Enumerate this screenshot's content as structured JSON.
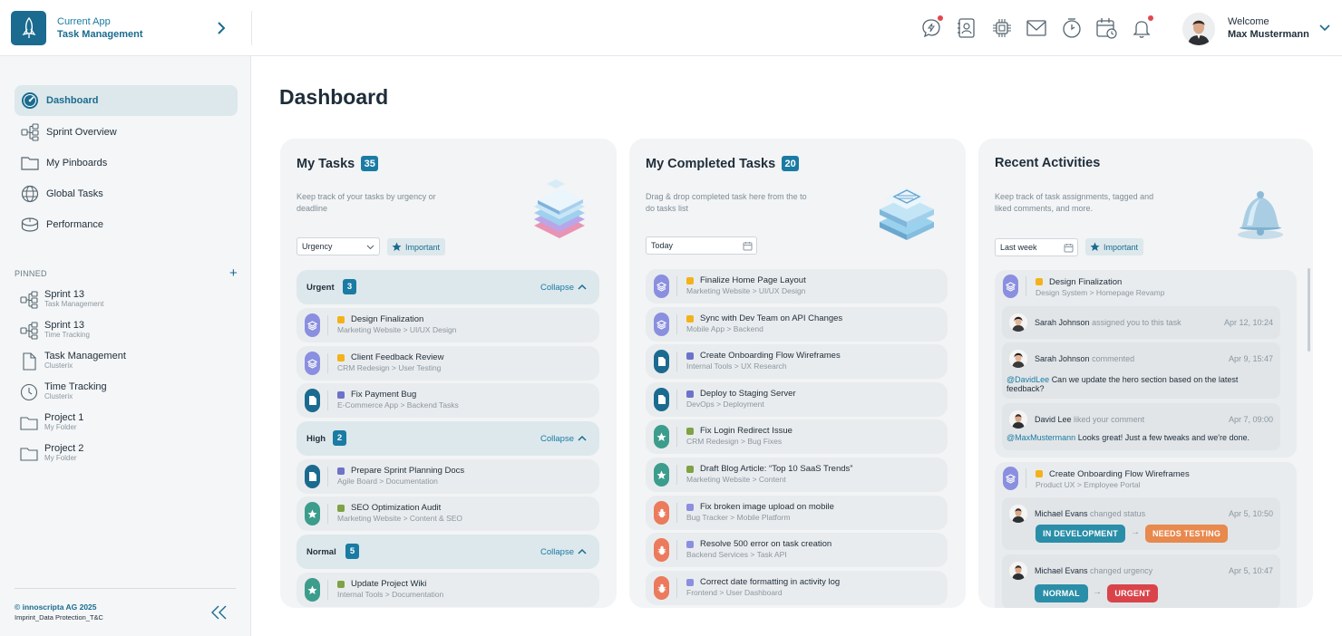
{
  "app": {
    "label": "Current App",
    "name": "Task Management"
  },
  "header": {
    "icons": [
      "chat-icon",
      "contacts-icon",
      "chip-icon",
      "mail-icon",
      "clock-icon",
      "calendar-icon",
      "bell-icon"
    ],
    "welcome": "Welcome",
    "user_name": "Max Mustermann"
  },
  "sidebar": {
    "items": [
      {
        "label": "Dashboard",
        "icon": "gauge-icon",
        "active": true
      },
      {
        "label": "Sprint Overview",
        "icon": "hierarchy-icon"
      },
      {
        "label": "My Pinboards",
        "icon": "folder-icon"
      },
      {
        "label": "Global Tasks",
        "icon": "globe-icon"
      },
      {
        "label": "Performance",
        "icon": "chart-icon"
      }
    ],
    "pinned_label": "PINNED",
    "pinned_add": "+",
    "pinned": [
      {
        "title": "Sprint 13",
        "sub": "Task Management",
        "icon": "hierarchy-icon"
      },
      {
        "title": "Sprint 13",
        "sub": "Time Tracking",
        "icon": "hierarchy-icon"
      },
      {
        "title": "Task Management",
        "sub": "Clusterix",
        "icon": "document-icon"
      },
      {
        "title": "Time Tracking",
        "sub": "Clusterix",
        "icon": "clock-icon"
      },
      {
        "title": "Project 1",
        "sub": "My Folder",
        "icon": "folder-icon"
      },
      {
        "title": "Project 2",
        "sub": "My Folder",
        "icon": "folder-icon"
      }
    ],
    "copyright": "© innoscripta AG 2025",
    "legal": "Imprint_Data Protection_T&C"
  },
  "page_title": "Dashboard",
  "my_tasks": {
    "title": "My Tasks",
    "count": "35",
    "desc": "Keep track of your tasks by urgency or deadline",
    "filter": "Urgency",
    "important": "Important",
    "collapse": "Collapse",
    "groups": [
      {
        "name": "Urgent",
        "count": "3"
      },
      {
        "name": "High",
        "count": "2"
      },
      {
        "name": "Normal",
        "count": "5"
      }
    ],
    "tasks": [
      {
        "title": "Design Finalization",
        "sub": "Marketing Website > UI/UX Design",
        "type": "layers-icon",
        "pill": "#8b8fe0",
        "sq": "#f3b21a"
      },
      {
        "title": "Client Feedback Review",
        "sub": "CRM Redesign > User Testing",
        "type": "layers-icon",
        "pill": "#8b8fe0",
        "sq": "#f3b21a"
      },
      {
        "title": "Fix Payment Bug",
        "sub": "E-Commerce App > Backend Tasks",
        "type": "document-icon",
        "pill": "#1a6b8f",
        "sq": "#6c73c9"
      },
      {
        "title": "Prepare Sprint Planning Docs",
        "sub": "Agile Board > Documentation",
        "type": "document-icon",
        "pill": "#1a6b8f",
        "sq": "#6c73c9"
      },
      {
        "title": "SEO Optimization Audit",
        "sub": "Marketing Website > Content & SEO",
        "type": "star-icon",
        "pill": "#3c9d8c",
        "sq": "#7ea244"
      },
      {
        "title": "Update Project Wiki",
        "sub": "Internal Tools > Documentation",
        "type": "star-icon",
        "pill": "#3c9d8c",
        "sq": "#7ea244"
      }
    ]
  },
  "completed": {
    "title": "My Completed Tasks",
    "count": "20",
    "desc": "Drag & drop completed task here from the to do tasks list",
    "filter": "Today",
    "tasks": [
      {
        "title": "Finalize Home Page Layout",
        "sub": "Marketing Website > UI/UX Design",
        "type": "layers-icon",
        "pill": "#8b8fe0",
        "sq": "#f3b21a"
      },
      {
        "title": "Sync with Dev Team on API Changes",
        "sub": "Mobile App > Backend",
        "type": "layers-icon",
        "pill": "#8b8fe0",
        "sq": "#f3b21a"
      },
      {
        "title": "Create Onboarding Flow Wireframes",
        "sub": "Internal Tools > UX Research",
        "type": "document-icon",
        "pill": "#1a6b8f",
        "sq": "#6c73c9"
      },
      {
        "title": "Deploy to Staging Server",
        "sub": "DevOps > Deployment",
        "type": "document-icon",
        "pill": "#1a6b8f",
        "sq": "#6c73c9"
      },
      {
        "title": "Fix Login Redirect Issue",
        "sub": "CRM Redesign > Bug Fixes",
        "type": "star-icon",
        "pill": "#3c9d8c",
        "sq": "#7ea244"
      },
      {
        "title": "Draft Blog Article: “Top 10 SaaS Trends”",
        "sub": "Marketing Website > Content",
        "type": "star-icon",
        "pill": "#3c9d8c",
        "sq": "#7ea244"
      },
      {
        "title": "Fix broken image upload on mobile",
        "sub": "Bug Tracker > Mobile Platform",
        "type": "bug-icon",
        "pill": "#ec7a5c",
        "sq": "#8b8fe0"
      },
      {
        "title": "Resolve 500 error on task creation",
        "sub": "Backend Services > Task API",
        "type": "bug-icon",
        "pill": "#ec7a5c",
        "sq": "#8b8fe0"
      },
      {
        "title": "Correct date formatting in activity log",
        "sub": "Frontend > User Dashboard",
        "type": "bug-icon",
        "pill": "#ec7a5c",
        "sq": "#8b8fe0"
      }
    ]
  },
  "activities": {
    "title": "Recent Activities",
    "desc": "Keep track of task assignments, tagged and liked comments, and more.",
    "filter": "Last week",
    "important": "Important",
    "blocks": [
      {
        "task": "Design Finalization",
        "path": "Design System > Homepage Revamp",
        "entries": [
          {
            "user": "Sarah Johnson",
            "action": "assigned you to this task",
            "time": "Apr 12, 10:24"
          },
          {
            "user": "Sarah Johnson",
            "action": "commented",
            "time": "Apr 9, 15:47",
            "mention": "@DavidLee",
            "message": "Can we update the hero section based on the latest feedback?"
          },
          {
            "user": "David Lee",
            "action": "liked your comment",
            "time": "Apr 7, 09:00",
            "mention": "@MaxMustermann",
            "message": "Looks great! Just a few tweaks and we're done."
          }
        ]
      },
      {
        "task": "Create Onboarding Flow Wireframes",
        "path": "Product UX > Employee Portal",
        "entries": [
          {
            "user": "Michael Evans",
            "action": "changed status",
            "time": "Apr 5, 10:50",
            "from": "IN DEVELOPMENT",
            "to": "NEEDS TESTING",
            "from_color": "#2a8ea8",
            "to_color": "#e8894e"
          },
          {
            "user": "Michael Evans",
            "action": "changed urgency",
            "time": "Apr 5, 10:47",
            "from": "NORMAL",
            "to": "URGENT",
            "from_color": "#2a8ea8",
            "to_color": "#d9444a"
          }
        ]
      }
    ]
  },
  "colors": {
    "accent": "#1a7ba3",
    "brand": "#1a6b8f",
    "card_bg": "#f2f4f5"
  }
}
